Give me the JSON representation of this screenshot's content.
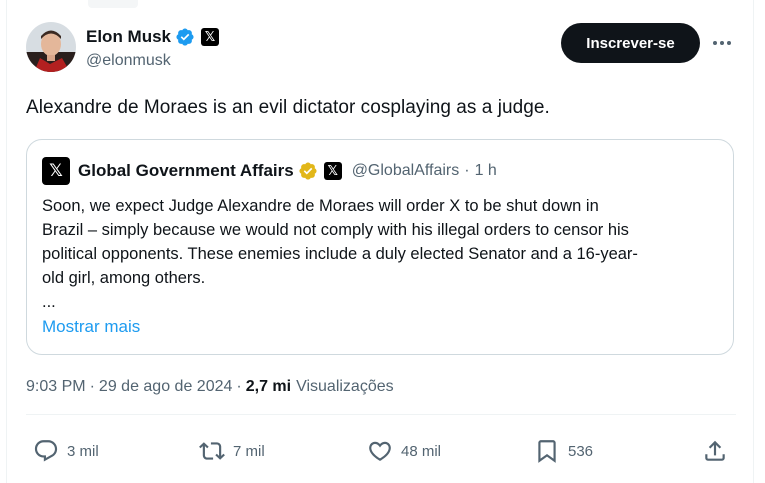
{
  "author": {
    "name": "Elon Musk",
    "handle": "@elonmusk"
  },
  "header": {
    "follow_label": "Inscrever-se"
  },
  "tweet": {
    "text": "Alexandre de Moraes is an evil dictator cosplaying as a judge."
  },
  "quote": {
    "name": "Global Government Affairs",
    "handle": "@GlobalAffairs",
    "separator": "·",
    "time": "1 h",
    "lines": [
      "Soon, we expect Judge Alexandre de Moraes will order X to be shut down in",
      "Brazil – simply because we would not comply with his illegal orders to censor his",
      "political opponents. These enemies include a duly elected Senator and a 16-year-",
      "old girl, among others.",
      "..."
    ],
    "show_more": "Mostrar mais"
  },
  "meta": {
    "time": "9:03 PM",
    "sep1": "·",
    "date": "29 de ago de 2024",
    "sep2": "·",
    "views_count": "2,7 mi",
    "views_label": "Visualizações"
  },
  "actions": {
    "replies": "3 mil",
    "reposts": "7 mil",
    "likes": "48 mil",
    "bookmarks": "536"
  },
  "icons": {
    "verified": "verified-badge-icon",
    "gold_verified": "gold-verified-badge-icon",
    "x_logo": "x-logo-icon",
    "more": "more-horizontal-icon",
    "reply": "reply-icon",
    "repost": "repost-icon",
    "like": "heart-icon",
    "bookmark": "bookmark-icon",
    "share": "share-icon"
  },
  "colors": {
    "accent_blue": "#1d9bf0",
    "text_primary": "#0f1419",
    "text_secondary": "#536471",
    "border": "#cfd9de",
    "gold": "#e2b719"
  }
}
